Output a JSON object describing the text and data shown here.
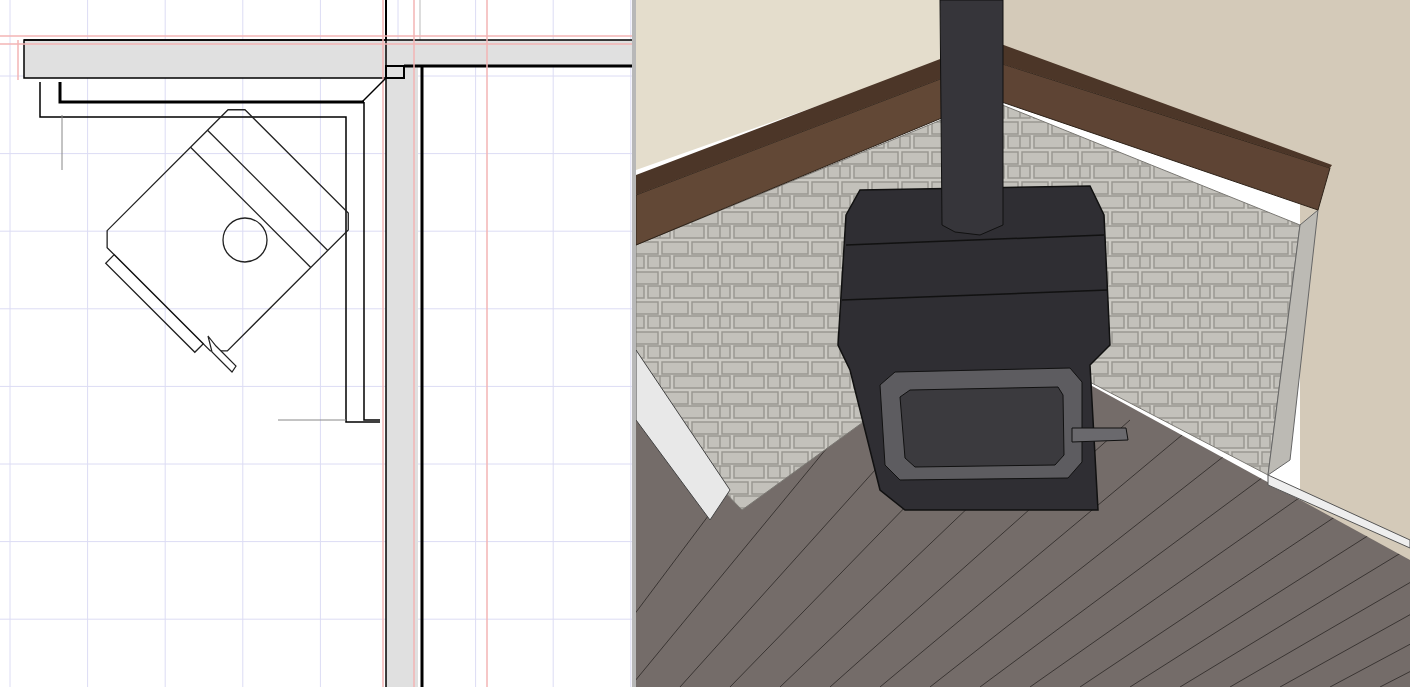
{
  "views": [
    {
      "kind": "plan"
    },
    {
      "kind": "render"
    }
  ]
}
